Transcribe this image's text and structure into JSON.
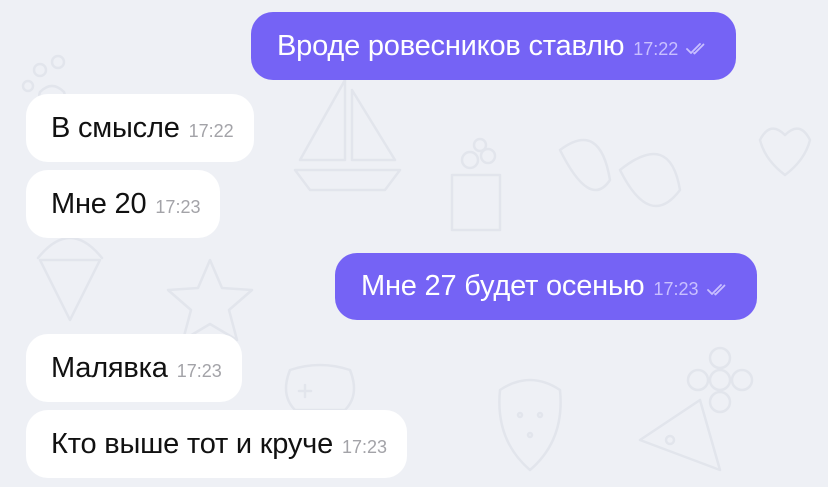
{
  "colors": {
    "background": "#eef0f5",
    "incoming_bubble": "#ffffff",
    "outgoing_bubble": "#7563f5",
    "incoming_time": "#a3a3a8",
    "outgoing_time": "#c9c0ff"
  },
  "messages": [
    {
      "direction": "outgoing",
      "text": "Вроде ровесников ставлю",
      "time": "17:22",
      "status_icon": "double-check-icon"
    },
    {
      "direction": "incoming",
      "text": "В смысле",
      "time": "17:22"
    },
    {
      "direction": "incoming",
      "text": "Мне 20",
      "time": "17:23"
    },
    {
      "direction": "outgoing",
      "text": "Мне 27 будет осенью",
      "time": "17:23",
      "status_icon": "double-check-icon"
    },
    {
      "direction": "incoming",
      "text": "Малявка",
      "time": "17:23"
    },
    {
      "direction": "incoming",
      "text": "Кто выше тот и круче",
      "time": "17:23"
    }
  ]
}
